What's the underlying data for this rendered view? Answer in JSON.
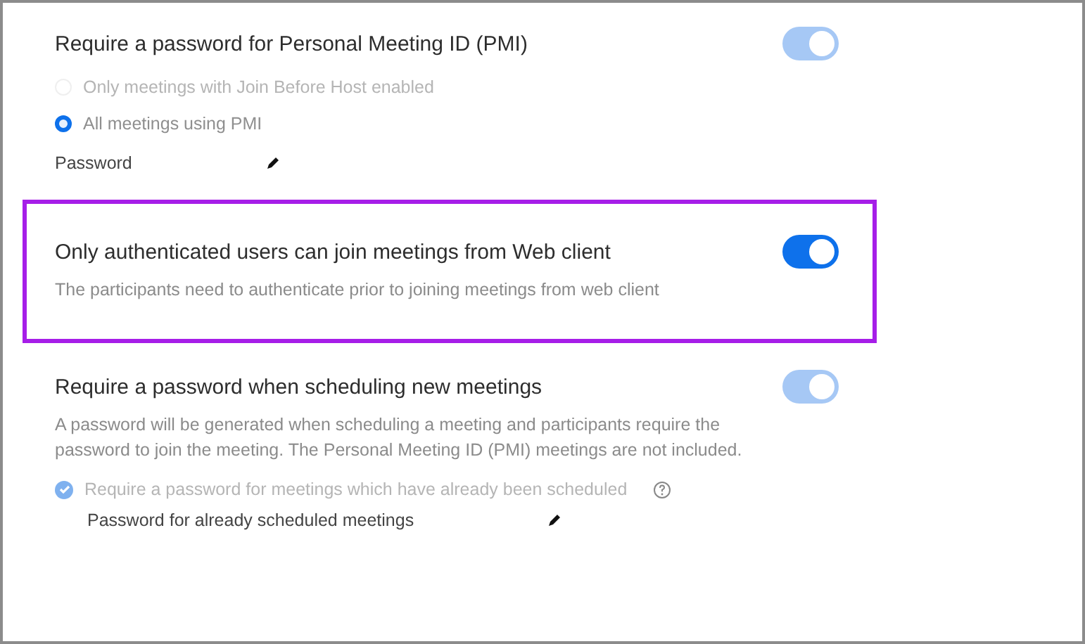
{
  "sections": [
    {
      "title": "Require a password for Personal Meeting ID (PMI)",
      "toggle": {
        "on": true,
        "disabled": true
      },
      "highlighted": false,
      "options": [
        {
          "kind": "radio",
          "label": "Only meetings with Join Before Host enabled",
          "selected": false,
          "disabled": true
        },
        {
          "kind": "radio",
          "label": "All meetings using PMI",
          "selected": true,
          "disabled": false
        }
      ],
      "password": {
        "label": "Password",
        "indented": false
      }
    },
    {
      "title": "Only authenticated users can join meetings from Web client",
      "description": "The participants need to authenticate prior to joining meetings from web client",
      "toggle": {
        "on": true,
        "disabled": false
      },
      "highlighted": true
    },
    {
      "title": "Require a password when scheduling new meetings",
      "description": "A password will be generated when scheduling a meeting and participants require the password to join the meeting. The Personal Meeting ID (PMI) meetings are not included.",
      "toggle": {
        "on": true,
        "disabled": true
      },
      "highlighted": false,
      "options": [
        {
          "kind": "checkbox",
          "label": "Require a password for meetings which have already been scheduled",
          "checked": true,
          "disabled": true,
          "help": true
        }
      ],
      "password": {
        "label": "Password for already scheduled meetings",
        "indented": true
      }
    }
  ]
}
